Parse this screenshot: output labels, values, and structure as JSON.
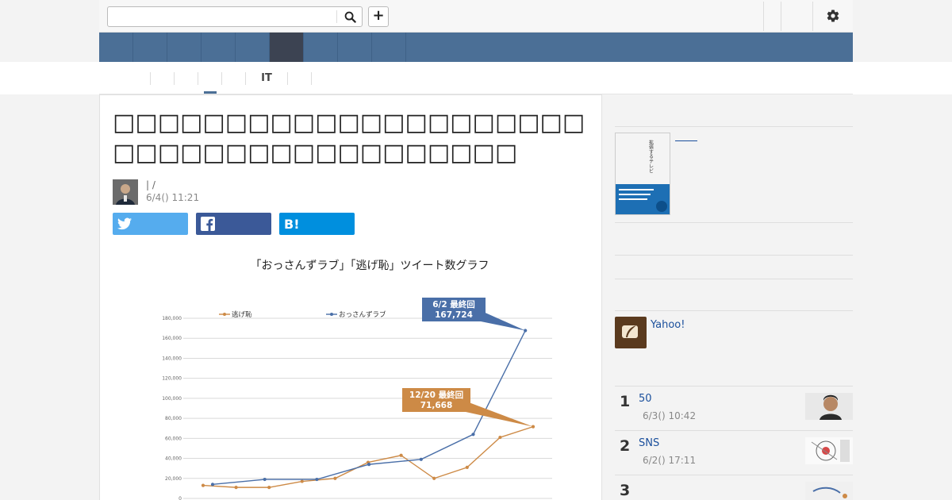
{
  "search": {
    "placeholder": "",
    "value": ""
  },
  "topbar": {
    "plus_label": "+"
  },
  "subnav": {
    "items": [
      "",
      "",
      "",
      "",
      "",
      "",
      "IT",
      "",
      ""
    ]
  },
  "article": {
    "title": "□□□□□□□□□□□□□□□□□□□□□□□□□□□□□□□□□□□□□□□",
    "byline": "| /",
    "date": "6/4() 11:21"
  },
  "share": {
    "hatena_label": "B!"
  },
  "chart_data": {
    "type": "line",
    "title": "「おっさんずラブ」「逃げ恥」ツイート数グラフ",
    "ylim": [
      0,
      180000
    ],
    "yticks": [
      "0",
      "20,000",
      "40,000",
      "60,000",
      "80,000",
      "100,000",
      "120,000",
      "140,000",
      "160,000",
      "180,000"
    ],
    "series": [
      {
        "name": "逃げ恥",
        "color": "#cd8a46",
        "values": [
          13000,
          11000,
          11000,
          17000,
          20000,
          36000,
          43000,
          20000,
          31000,
          61000,
          71668
        ]
      },
      {
        "name": "おっさんずラブ",
        "color": "#4a6fa8",
        "values": [
          14000,
          19000,
          19000,
          34000,
          39000,
          64000,
          167724
        ]
      }
    ],
    "annotations": [
      {
        "lines": [
          "6/2 最終回",
          "167,724"
        ],
        "color": "#4a6fa8"
      },
      {
        "lines": [
          "12/20 最終回",
          "71,668"
        ],
        "color": "#cd8a46"
      }
    ]
  },
  "sidebar": {
    "book": {
      "title": "拡張するテレビ"
    },
    "yahoo_label": "Yahoo!",
    "ranking": [
      {
        "rank": "1",
        "title": "50",
        "date": "6/3() 10:42"
      },
      {
        "rank": "2",
        "title": "SNS",
        "date": "6/2() 17:11"
      },
      {
        "rank": "3",
        "title": "",
        "date": ""
      }
    ]
  },
  "colors": {
    "nav": "#4b6f96",
    "nav_active": "#3c4352",
    "twitter": "#55acee",
    "facebook": "#3b5998",
    "hatena": "#008fde"
  }
}
